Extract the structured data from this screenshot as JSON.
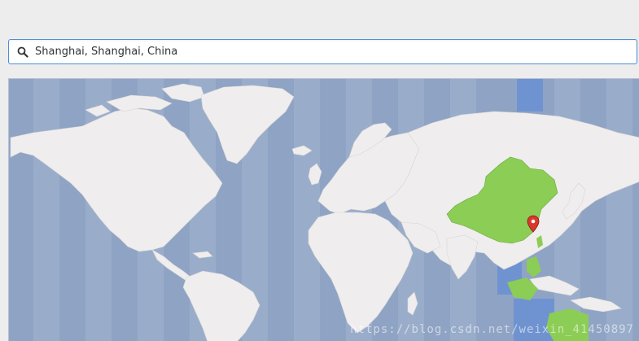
{
  "search": {
    "value": "Shanghai, Shanghai, China",
    "icon": "search-icon"
  },
  "map": {
    "ocean_color": "#8fa3c4",
    "band_color": "#99adcb",
    "selected_band_color": "#6f93d0",
    "land_color": "#efeded",
    "selected_region_color": "#8ccd55",
    "marker_color": "#d9382c",
    "selected_city": "Shanghai"
  },
  "watermark": "https://blog.csdn.net/weixin_41450897"
}
